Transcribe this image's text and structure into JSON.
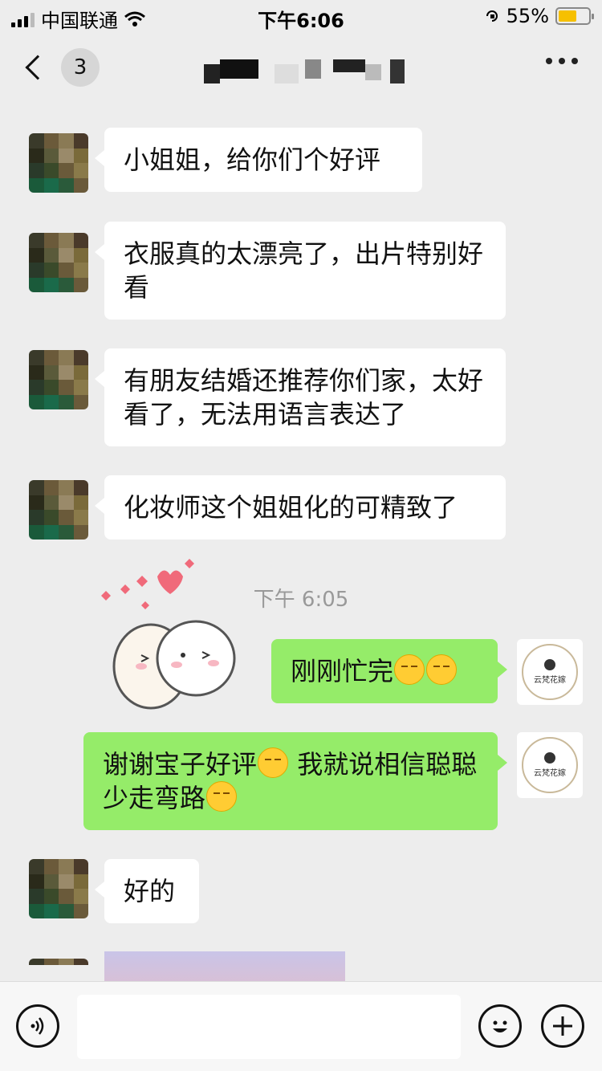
{
  "status_bar": {
    "carrier": "中国联通",
    "time": "下午6:06",
    "battery": "55%",
    "battery_level": 0.55
  },
  "nav": {
    "back_badge": "3",
    "title_obscured": true
  },
  "messages": [
    {
      "side": "left",
      "text": "小姐姐，给你们个好评"
    },
    {
      "side": "left",
      "text": "衣服真的太漂亮了，出片特别好看"
    },
    {
      "side": "left",
      "text": "有朋友结婚还推荐你们家，太好看了，无法用语言表达了"
    },
    {
      "side": "left",
      "text": "化妆师这个姐姐化的可精致了"
    },
    {
      "type": "timestamp",
      "text": "下午 6:05"
    },
    {
      "side": "right",
      "text": "刚刚忙完",
      "emojis": [
        "smirk-emoji",
        "smirk-emoji"
      ]
    },
    {
      "side": "right",
      "text_a": "谢谢宝子好评",
      "text_b": " 我就说相信聪聪少走弯路",
      "emojis": [
        "blush-emoji",
        "hand-over-mouth-emoji"
      ]
    },
    {
      "side": "left",
      "text": "好的"
    }
  ],
  "brand": {
    "name": "云梵花嫁"
  },
  "icons": {
    "back": "chevron-left-icon",
    "more": "more-icon",
    "voice": "voice-icon",
    "emoji": "emoji-icon",
    "plus": "plus-icon"
  },
  "colors": {
    "background": "#ededed",
    "bubble_left": "#ffffff",
    "bubble_right": "#95ec69"
  }
}
